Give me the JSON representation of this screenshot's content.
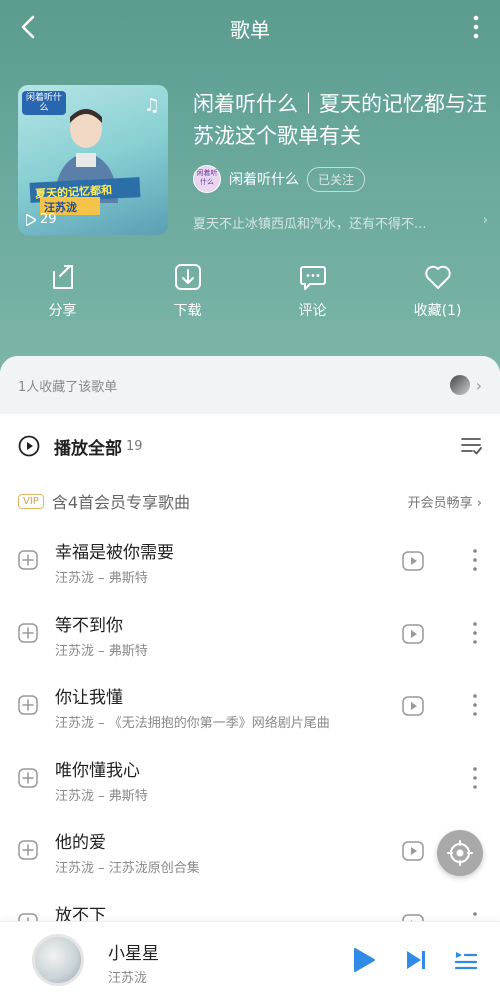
{
  "topbar": {
    "title": "歌单"
  },
  "playlist": {
    "title": "闲着听什么｜夏天的记忆都与汪苏泷这个歌单有关",
    "play_count": "29",
    "cover_text": {
      "badge": "闲着听什么",
      "banner1": "夏天的记忆都和",
      "banner2": "汪苏泷"
    },
    "creator_name": "闲着听什么",
    "creator_avatar_text": "闲着听什么",
    "follow_label": "已关注",
    "description": "夏天不止冰镇西瓜和汽水，还有不得不..."
  },
  "actions": [
    {
      "icon": "share-icon",
      "label": "分享"
    },
    {
      "icon": "download-icon",
      "label": "下载"
    },
    {
      "icon": "comment-icon",
      "label": "评论"
    },
    {
      "icon": "heart-icon",
      "label": "收藏(1)"
    }
  ],
  "favorites": {
    "text": "1人收藏了该歌单"
  },
  "play_all": {
    "label": "播放全部",
    "count": "19"
  },
  "vip": {
    "tag": "VIP",
    "text": "含4首会员专享歌曲",
    "open_label": "开会员畅享 ›"
  },
  "songs": [
    {
      "title": "幸福是被你需要",
      "meta": "汪苏泷 – 弗斯特",
      "has_mv": true
    },
    {
      "title": "等不到你",
      "meta": "汪苏泷 – 弗斯特",
      "has_mv": true
    },
    {
      "title": "你让我懂",
      "meta": "汪苏泷 – 《无法拥抱的你第一季》网络剧片尾曲",
      "has_mv": true
    },
    {
      "title": "唯你懂我心",
      "meta": "汪苏泷 – 弗斯特",
      "has_mv": false
    },
    {
      "title": "他的爱",
      "meta": "汪苏泷 – 汪苏泷原创合集",
      "has_mv": true
    },
    {
      "title": "放不下",
      "meta": "",
      "has_mv": true
    }
  ],
  "now_playing": {
    "title": "小星星",
    "artist": "汪苏泷"
  },
  "colors": {
    "header": "#6aa99c",
    "accent": "#2f8be6"
  }
}
